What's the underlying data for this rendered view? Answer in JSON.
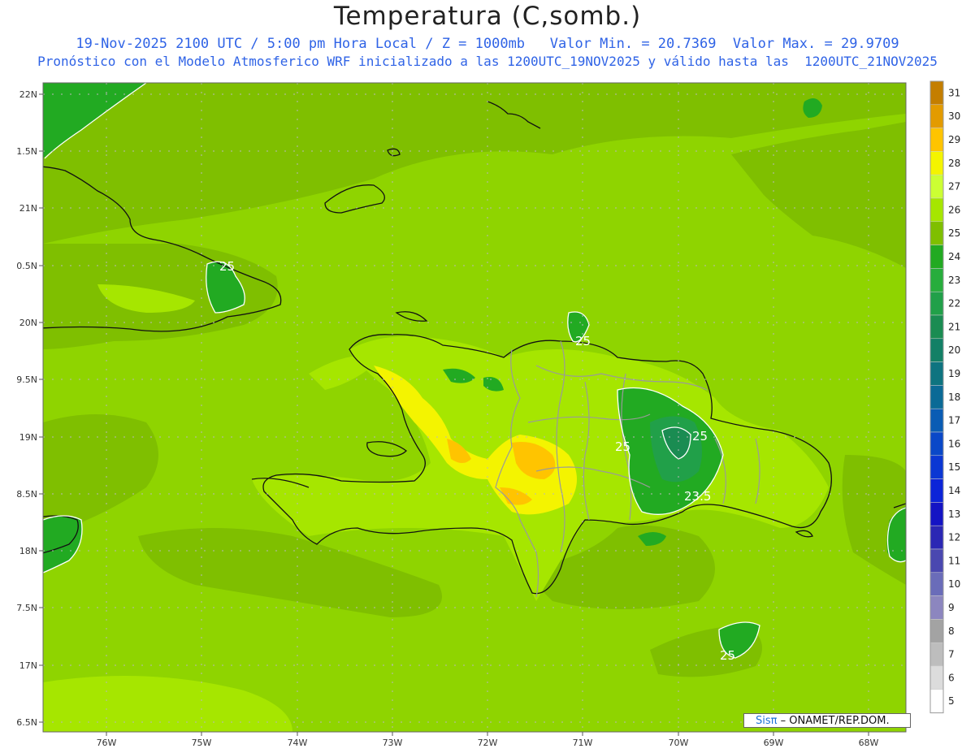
{
  "title": "Temperatura (C,somb.)",
  "subtitle_line1": "19-Nov-2025 2100 UTC / 5:00 pm Hora Local / Z = 1000mb   Valor Min. = 20.7369  Valor Max. = 29.9709",
  "subtitle_line2": "Pronóstico con el Modelo Atmosferico WRF inicializado a las 1200UTC_19NOV2025 y válido hasta las  1200UTC_21NOV2025",
  "credit": {
    "sis": "Sisπ",
    "rest": " – ONAMET/REP.DOM."
  },
  "lat_labels": [
    "22N",
    "1.5N",
    "21N",
    "0.5N",
    "20N",
    "9.5N",
    "19N",
    "8.5N",
    "18N",
    "7.5N",
    "17N",
    "6.5N"
  ],
  "lon_labels": [
    "76W",
    "75W",
    "74W",
    "73W",
    "72W",
    "71W",
    "70W",
    "69W",
    "68W"
  ],
  "contour_labels": [
    "25",
    "25",
    "25",
    "25",
    "25",
    "23.5",
    "25"
  ],
  "colorbar": {
    "levels": [
      "31",
      "30",
      "29",
      "28",
      "27",
      "26",
      "25",
      "24",
      "23",
      "22",
      "21",
      "20",
      "19",
      "18",
      "17",
      "16",
      "15",
      "14",
      "13",
      "12",
      "11",
      "10",
      "9",
      "8",
      "7",
      "6",
      "5"
    ],
    "colors": [
      "#c47e00",
      "#e39b00",
      "#ffc400",
      "#f4f400",
      "#ccff33",
      "#a6e600",
      "#7fbf00",
      "#22aa22",
      "#27ad3c",
      "#21a049",
      "#1a8c52",
      "#138066",
      "#0e7480",
      "#0b6a96",
      "#0a5cb4",
      "#0a48c8",
      "#0b37d3",
      "#0c24d8",
      "#1414c4",
      "#2b27b4",
      "#4a48b0",
      "#6a6cb9",
      "#8c86bf",
      "#a3a3a3",
      "#bdbdbd",
      "#dcdcdc",
      "#ffffff"
    ]
  },
  "map_colors": {
    "ocean": "#8fd400",
    "land_warm": "#a6e600",
    "coast": "#111111",
    "borders": "#9a9a9a",
    "grid": "#b8b8b8"
  }
}
